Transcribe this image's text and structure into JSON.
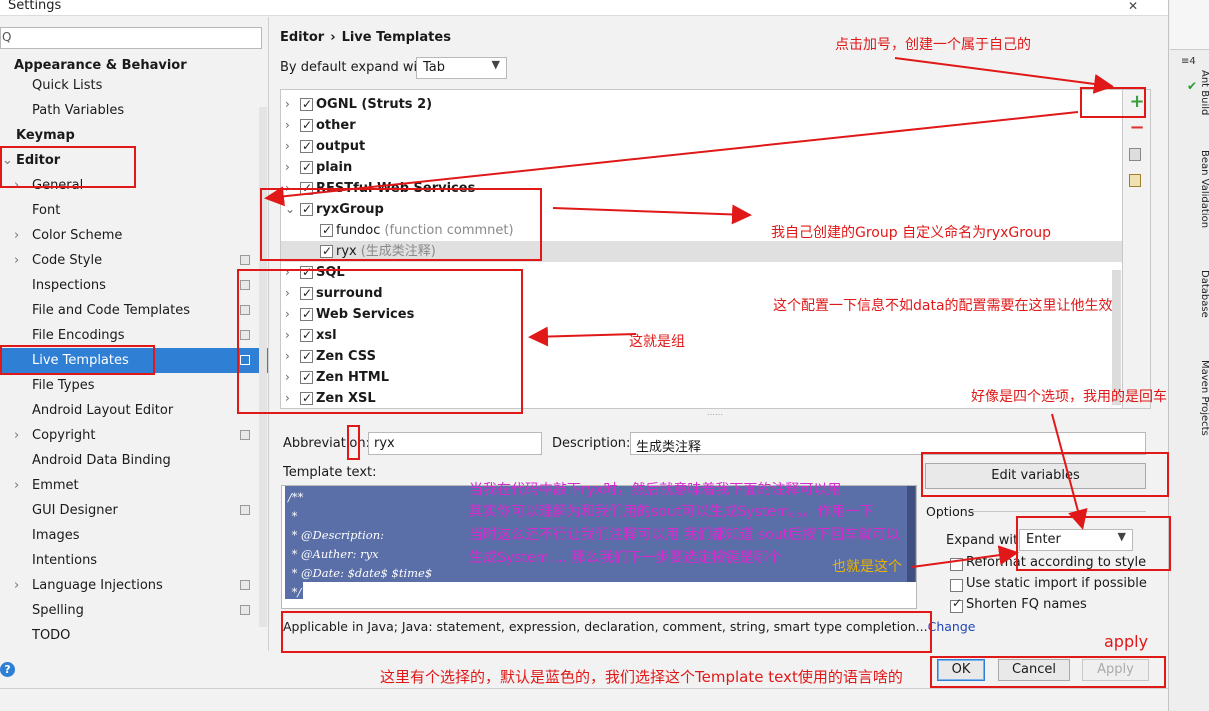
{
  "window": {
    "title": "Settings",
    "close": "✕"
  },
  "nav": {
    "search_icon": "Q",
    "items": [
      {
        "label": "Appearance & Behavior",
        "bold": true
      },
      {
        "label": "Quick Lists"
      },
      {
        "label": "Path Variables"
      },
      {
        "label": "Keymap",
        "bold": true
      },
      {
        "label": "Editor",
        "bold": true
      },
      {
        "label": "General"
      },
      {
        "label": "Font"
      },
      {
        "label": "Color Scheme"
      },
      {
        "label": "Code Style"
      },
      {
        "label": "Inspections"
      },
      {
        "label": "File and Code Templates"
      },
      {
        "label": "File Encodings"
      },
      {
        "label": "Live Templates",
        "selected": true
      },
      {
        "label": "File Types"
      },
      {
        "label": "Android Layout Editor"
      },
      {
        "label": "Copyright"
      },
      {
        "label": "Android Data Binding"
      },
      {
        "label": "Emmet"
      },
      {
        "label": "GUI Designer"
      },
      {
        "label": "Images"
      },
      {
        "label": "Intentions"
      },
      {
        "label": "Language Injections"
      },
      {
        "label": "Spelling"
      },
      {
        "label": "TODO"
      }
    ]
  },
  "breadcrumb": [
    "Editor",
    "›",
    "Live Templates"
  ],
  "expand_default": {
    "label": "By default expand with",
    "value": "Tab"
  },
  "tree": [
    {
      "name": "OGNL (Struts 2)"
    },
    {
      "name": "other"
    },
    {
      "name": "output"
    },
    {
      "name": "plain"
    },
    {
      "name": "RESTful Web Services"
    },
    {
      "name": "ryxGroup",
      "expanded": true
    },
    {
      "name": "fundoc",
      "desc": "(function commnet)",
      "child": true
    },
    {
      "name": "ryx",
      "desc": "(生成类注释)",
      "child": true,
      "highlight": true
    },
    {
      "name": "SQL"
    },
    {
      "name": "surround"
    },
    {
      "name": "Web Services"
    },
    {
      "name": "xsl"
    },
    {
      "name": "Zen CSS"
    },
    {
      "name": "Zen HTML"
    },
    {
      "name": "Zen XSL"
    }
  ],
  "toolbar": {
    "add": "+",
    "remove": "−"
  },
  "abbreviation": {
    "label": "Abbreviation:",
    "value": "ryx"
  },
  "description": {
    "label": "Description:",
    "value": "生成类注释"
  },
  "template_text": {
    "label": "Template text:",
    "lines": [
      "/**",
      " *",
      " * @Description:",
      " * @Auther: ryx",
      " * @Date: $date$ $time$",
      " */"
    ]
  },
  "edit_variables": "Edit variables",
  "options": {
    "label": "Options",
    "expand_with_label": "Expand with",
    "expand_with_value": "Enter",
    "reformat": "Reformat according to style",
    "static_import": "Use static import if possible",
    "shorten_fq": "Shorten FQ names"
  },
  "applicable": {
    "text": "Applicable in Java; Java: statement, expression, declaration, comment, string, smart type completion...",
    "link": "Change"
  },
  "buttons": {
    "help": "?",
    "ok": "OK",
    "cancel": "Cancel",
    "apply": "Apply"
  },
  "ide_strip": {
    "num": "≡4",
    "tabs": [
      "Ant Build",
      "Bean Validation",
      "Database",
      "Maven Projects"
    ]
  },
  "annotations": {
    "add_hint": "点击加号，创建一个属于自己的",
    "group_hint": "我自己创建的Group  自定义命名为ryxGroup",
    "config_hint": "这个配置一下信息不如data的配置需要在这里让他生效",
    "group_word": "这就是组",
    "four_options": "好像是四个选项，我用的是回车",
    "explain_1": "当我在代码中敲下ryx时，然后就意味着我下面的注释可以用",
    "explain_2": "其实你可以理解为和我们用的sout可以生成System。。。作用一下",
    "explain_3": "当时这么还不行让我们注释可以用  我们都知道 sout后按下回车就可以",
    "explain_4": "生成System....   那么我们下一步要选定按键是哪个",
    "this_one": "也就是这个",
    "apply_hint": "apply",
    "bottom_hint": "这里有个选择的，默认是蓝色的，我们选择这个Template text使用的语言啥的"
  },
  "colors": {
    "selection": "#2f7fd5",
    "annotation": "#e01818",
    "template_bg": "#5a6fa8"
  }
}
